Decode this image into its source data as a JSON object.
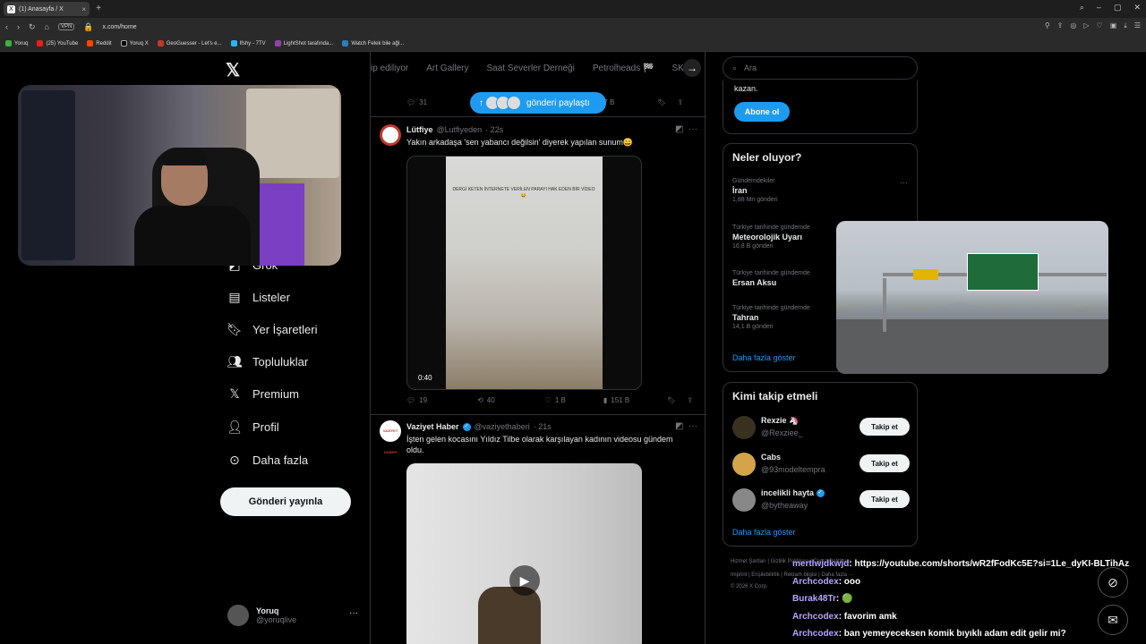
{
  "browser": {
    "tab_title": "(1) Anasayfa / X",
    "url": "x.com/home",
    "vpn": "VPN",
    "bookmarks": [
      "Yoruq",
      "(25) YouTube",
      "Reddit",
      "Yoruq X",
      "GeoGuesser - Let's e...",
      "Ifshy - 7TV",
      "LightShot tarafında...",
      "Watch Felek bile ağl..."
    ]
  },
  "nav": {
    "items": [
      "Grok",
      "Listeler",
      "Yer İşaretleri",
      "Topluluklar",
      "Premium",
      "Profil",
      "Daha fazla"
    ],
    "post_button": "Gönderi yayınla",
    "account_name": "Yoruq",
    "account_handle": "@yoruqlive"
  },
  "main": {
    "categories": [
      "ip ediliyor",
      "Art Gallery",
      "Saat Severler Derneği",
      "Petrolheads 🏁",
      "SK"
    ],
    "new_posts_pill": "gönderi paylaştı",
    "top_actions": {
      "replies": "31",
      "views": "707 B"
    },
    "tweets": [
      {
        "name": "Lütfiye",
        "handle": "@Lutfiyeden",
        "time": "· 22s",
        "text": "Yakın arkadaşa 'sen yabancı değilsin' diyerek yapılan sunum😄",
        "video_caption": "DERGİ KETEN İNTERNETE VERİLEN PARAYI HAK EDEN BİR VİDEO 😂",
        "duration": "0:40",
        "replies": "19",
        "retweets": "40",
        "likes": "1 B",
        "views": "151 B"
      },
      {
        "name": "Vaziyet Haber",
        "handle": "@vaziyethaberi",
        "time": "· 21s",
        "text": "İşten gelen kocasını Yıldız Tilbe olarak karşılayan kadının videosu gündem oldu.",
        "avatar_text": "VAZİYET HABER"
      }
    ]
  },
  "right": {
    "search_placeholder": "Ara",
    "subscribe_text": "kazan.",
    "subscribe_button": "Abone ol",
    "trends_title": "Neler oluyor?",
    "trends": [
      {
        "category": "Gündemdekiler",
        "title": "İran",
        "posts": "1,88 Mn gönderi"
      },
      {
        "category": "Türkiye tarihinde gündemde",
        "title": "Meteorolojik Uyarı",
        "posts": "16,8 B gönderi"
      },
      {
        "category": "Türkiye tarihinde gündemde",
        "title": "Ersan Aksu",
        "posts": ""
      },
      {
        "category": "Türkiye tarihinde gündemde",
        "title": "Tahran",
        "posts": "14,1 B gönderi"
      }
    ],
    "trends_more": "Daha fazla göster",
    "follow_title": "Kimi takip etmeli",
    "follow": [
      {
        "name": "Rexzie 🦄",
        "handle": "@Rexziee_",
        "button": "Takip et"
      },
      {
        "name": "Cabs",
        "handle": "@93modeltempra",
        "button": "Takip et"
      },
      {
        "name": "incelikli hayta",
        "handle": "@bytheaway",
        "button": "Takip et"
      }
    ],
    "follow_more": "Daha fazla göster",
    "footer1": "Hizmet Şartları  |  Gizlilik Politikası  |  Çerez Politikası",
    "footer2": "Imprint  |  Erişilebilirlik  |  Reklam bilgisi  |  Daha fazla ···",
    "footer3": "© 2026 X Corp."
  },
  "chat": [
    {
      "user": "mertlwjdkwjd",
      "msg": ": https://youtube.com/shorts/wR2fFodKc5E?si=1Le_dyKI-BLTihAz"
    },
    {
      "user": "Archcodex",
      "msg": ": ooo"
    },
    {
      "user": "Burak48Tr",
      "msg": ": 🟢"
    },
    {
      "user": "Archcodex",
      "msg": ": favorim amk"
    },
    {
      "user": "Archcodex",
      "msg": ": ban yemeyeceksen komik bıyıklı adam edit gelir mi?"
    }
  ]
}
